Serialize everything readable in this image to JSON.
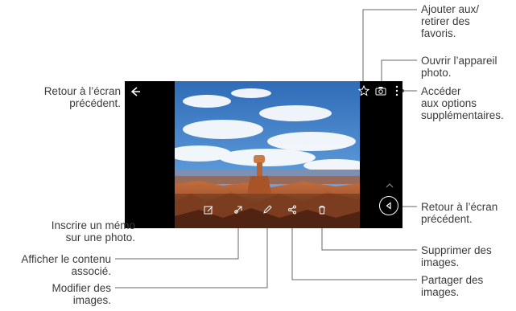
{
  "callouts": {
    "favorites": [
      "Ajouter aux/",
      "retirer des",
      "favoris."
    ],
    "camera": [
      "Ouvrir l’appareil",
      "photo."
    ],
    "more_options": [
      "Accéder",
      "aux options",
      "supplémentaires."
    ],
    "back_top": [
      "Retour à l’écran",
      "précédent."
    ],
    "back_bottom": [
      "Retour à l’écran",
      "précédent."
    ],
    "memo": [
      "Inscrire un mémo",
      "sur une photo."
    ],
    "related": [
      "Afficher le contenu",
      "associé."
    ],
    "edit": [
      "Modifier des",
      "images."
    ],
    "delete": [
      "Supprimer des",
      "images."
    ],
    "share": [
      "Partager des",
      "images."
    ]
  },
  "colors": {
    "screen_bg": "#000000",
    "label_text": "#3a3a3a",
    "leader_line": "#555555",
    "icon_white": "#ffffff"
  },
  "icons": [
    "back-arrow-icon",
    "star-icon",
    "camera-icon",
    "more-vertical-icon",
    "memo-icon",
    "related-content-icon",
    "edit-pencil-icon",
    "share-icon",
    "trash-icon",
    "chevron-up-icon",
    "back-triangle-icon"
  ]
}
